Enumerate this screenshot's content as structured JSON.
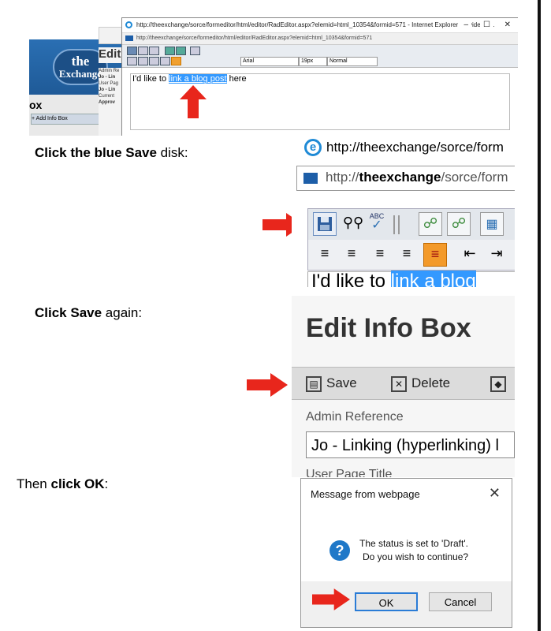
{
  "top_shot": {
    "site_logo_line1": "the",
    "site_logo_line2": "Exchange",
    "site_section_label": "ox",
    "site_add_button": "Add Info Box",
    "edit_label": "Edit",
    "side_labels": [
      "Admin Re",
      "Jo - Lin",
      "User Pag",
      "Jo - Lin",
      "Current",
      "Approv"
    ],
    "window_title": "http://theexchange/sorce/formeditor/html/editor/RadEditor.aspx?elemid=html_10354&formid=571 - Internet Explorer provided b...",
    "url": "http://theexchange/sorce/formeditor/html/editor/RadEditor.aspx?elemid=html_10354&formid=571",
    "font_name": "Arial",
    "font_size": "19px",
    "paragraph_style": "Normal",
    "body_text_before": "I'd like to ",
    "body_text_link": "link a blog post",
    "body_text_after": " here",
    "window_controls": [
      "–",
      "☐",
      "✕"
    ]
  },
  "steps": [
    {
      "bold": "Click the blue Save",
      "rest": " disk:"
    },
    {
      "bold": "Click Save",
      "rest": " again:"
    },
    {
      "prefix": "Then ",
      "bold": "click OK",
      "rest": ":"
    }
  ],
  "toolbar_shot": {
    "ie_title": "http://theexchange/sorce/form",
    "url_prefix": "http://",
    "url_host": "theexchange",
    "url_rest": "/sorce/form",
    "doc_text_before": "I'd like to ",
    "doc_text_link": "link a blog"
  },
  "edit_shot": {
    "title": "Edit Info Box",
    "save_label": "Save",
    "delete_label": "Delete",
    "admin_ref_label": "Admin Reference",
    "admin_ref_value": "Jo - Linking (hyperlinking) l",
    "user_page_title_label": "User Page Title"
  },
  "dialog": {
    "title": "Message from webpage",
    "close": "✕",
    "line1": "The status is set to 'Draft'.",
    "line2": "Do you wish to continue?",
    "ok_label": "OK",
    "cancel_label": "Cancel"
  },
  "colors": {
    "arrow_red": "#e8261c",
    "highlight_blue": "#3399ff",
    "site_blue": "#2a6fb3"
  }
}
